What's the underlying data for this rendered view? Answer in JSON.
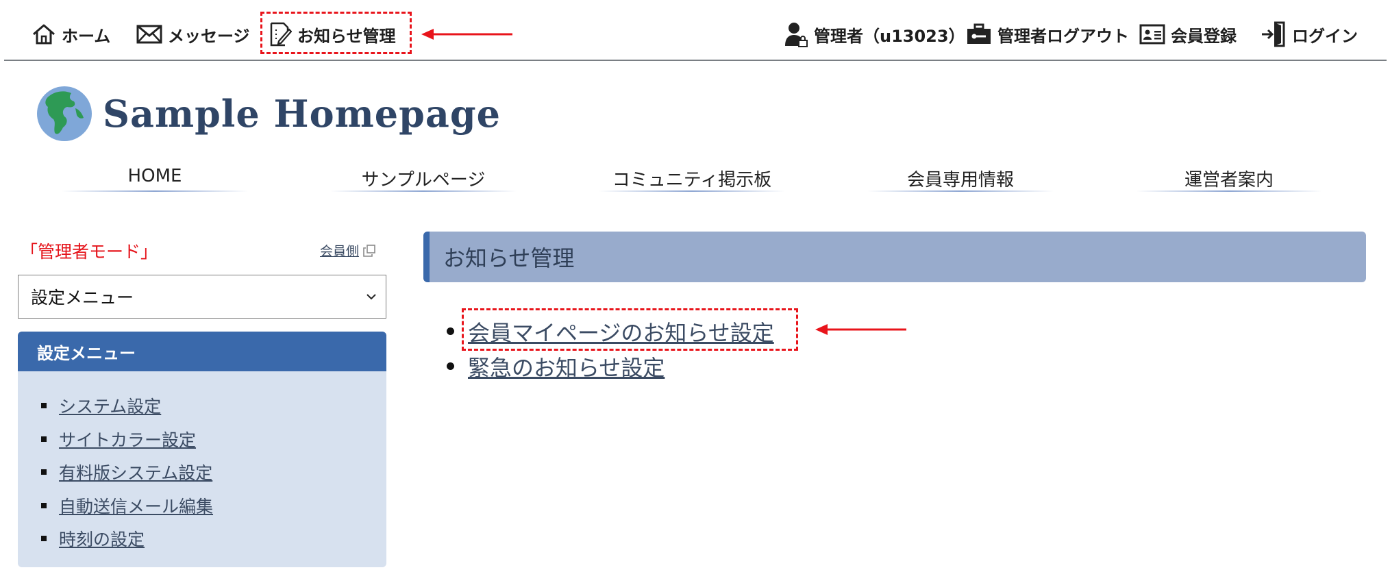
{
  "topnav": {
    "home": "ホーム",
    "messages": "メッセージ",
    "notice_admin": "お知らせ管理",
    "admin_user": "管理者（u13023）",
    "admin_logout": "管理者ログアウト",
    "member_register": "会員登録",
    "login": "ログイン"
  },
  "logo": {
    "text": "Sample Homepage"
  },
  "mainnav": {
    "items": [
      {
        "label": "HOME"
      },
      {
        "label": "サンプルページ"
      },
      {
        "label": "コミュニティ掲示板"
      },
      {
        "label": "会員専用情報"
      },
      {
        "label": "運営者案内"
      }
    ]
  },
  "sidebar": {
    "mode_label": "「管理者モード」",
    "member_side_link": "会員側",
    "select_value": "設定メニュー",
    "menu_title": "設定メニュー",
    "menu_items": [
      {
        "label": "システム設定"
      },
      {
        "label": "サイトカラー設定"
      },
      {
        "label": "有料版システム設定"
      },
      {
        "label": "自動送信メール編集"
      },
      {
        "label": "時刻の設定"
      }
    ]
  },
  "content": {
    "heading": "お知らせ管理",
    "links": [
      {
        "label": "会員マイページのお知らせ設定"
      },
      {
        "label": "緊急のお知らせ設定"
      }
    ]
  },
  "colors": {
    "accent_blue": "#3a69ab",
    "heading_bg": "#98abcc",
    "menu_bg": "#d7e1ef",
    "annotation_red": "#e8141b",
    "admin_red": "#e5141b",
    "link_color": "#3b4b63"
  }
}
